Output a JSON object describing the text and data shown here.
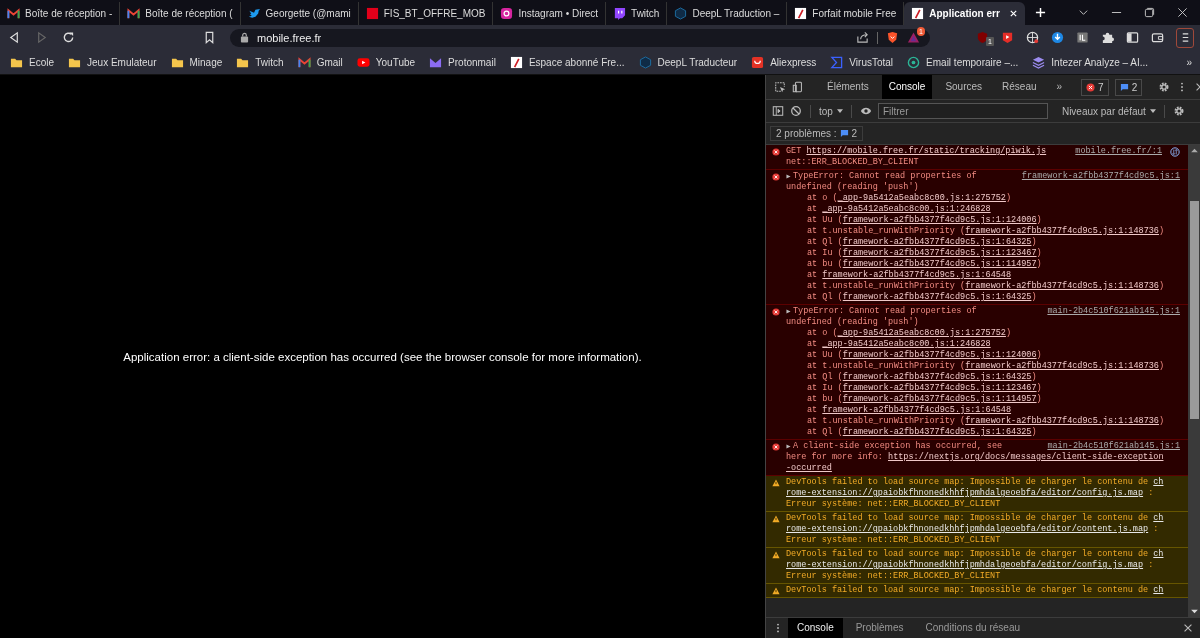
{
  "browser_tabs": [
    {
      "title": "Boîte de réception -",
      "kind": "gmail",
      "selected": false
    },
    {
      "title": "Boîte de réception (",
      "kind": "gmail",
      "selected": false
    },
    {
      "title": "Georgette (@mami",
      "kind": "twitter",
      "selected": false
    },
    {
      "title": "FIS_BT_OFFRE_MOB",
      "kind": "sfr",
      "selected": false
    },
    {
      "title": "Instagram • Direct",
      "kind": "instagram",
      "selected": false
    },
    {
      "title": "Twitch",
      "kind": "twitch",
      "selected": false
    },
    {
      "title": "DeepL Traduction –",
      "kind": "deepl",
      "selected": false
    },
    {
      "title": "Forfait mobile Free",
      "kind": "free",
      "selected": false
    },
    {
      "title": "Application err",
      "kind": "free",
      "selected": true
    }
  ],
  "toolbar": {
    "address": "mobile.free.fr",
    "rewards_badge": "1",
    "extensions": [
      {
        "kind": "shield",
        "badge": "1"
      },
      {
        "kind": "play"
      },
      {
        "kind": "globe"
      },
      {
        "kind": "download"
      },
      {
        "kind": "square"
      },
      {
        "kind": "puzzle"
      },
      {
        "kind": "sidebar"
      },
      {
        "kind": "wallet"
      }
    ]
  },
  "bookmarks": [
    {
      "label": "Ecole",
      "kind": "folder"
    },
    {
      "label": "Jeux Emulateur",
      "kind": "folder"
    },
    {
      "label": "Minage",
      "kind": "folder"
    },
    {
      "label": "Twitch",
      "kind": "folder"
    },
    {
      "label": "Gmail",
      "kind": "gmail"
    },
    {
      "label": "YouTube",
      "kind": "youtube"
    },
    {
      "label": "Protonmail",
      "kind": "proton"
    },
    {
      "label": "Espace abonné Fre...",
      "kind": "free"
    },
    {
      "label": "DeepL Traducteur",
      "kind": "deepl"
    },
    {
      "label": "Aliexpress",
      "kind": "aliexpress"
    },
    {
      "label": "VirusTotal",
      "kind": "virustotal"
    },
    {
      "label": "Email temporaire –...",
      "kind": "email"
    },
    {
      "label": "Intezer Analyze – AI...",
      "kind": "intezer"
    }
  ],
  "bookmarks_more": "»",
  "page": {
    "message": "Application error: a client-side exception has occurred (see the browser console for more information)."
  },
  "devtools": {
    "tabs": [
      {
        "label": "Éléments",
        "selected": false
      },
      {
        "label": "Console",
        "selected": true
      },
      {
        "label": "Sources",
        "selected": false
      },
      {
        "label": "Réseau",
        "selected": false
      }
    ],
    "tabs_more": "»",
    "error_count": "7",
    "message_count": "2",
    "context": "top",
    "filter_placeholder": "Filtrer",
    "levels": "Niveaux par défaut",
    "issues_label": "2 problèmes :",
    "issues_count": "2",
    "messages": [
      {
        "kind": "request",
        "source": "mobile.free.fr/:1",
        "lines": [
          [
            {
              "kind": "text",
              "text": "GET "
            },
            {
              "kind": "link",
              "text": "https://mobile.free.fr/static/tracking/piwik.js"
            }
          ],
          [
            {
              "kind": "text",
              "text": "net::ERR_BLOCKED_BY_CLIENT"
            }
          ]
        ]
      },
      {
        "kind": "exception",
        "source": "framework-a2fbb4377f4cd9c5.js:1",
        "lines": [
          [
            {
              "kind": "text",
              "text": "TypeError: Cannot read properties of"
            }
          ],
          [
            {
              "kind": "text",
              "text": "undefined (reading 'push')"
            }
          ]
        ],
        "stack": [
          [
            {
              "kind": "text",
              "text": "at o ("
            },
            {
              "kind": "link",
              "text": "_app-9a5412a5eabc8c00.js:1:275752"
            },
            {
              "kind": "text",
              "text": ")"
            }
          ],
          [
            {
              "kind": "text",
              "text": "at "
            },
            {
              "kind": "link",
              "text": "_app-9a5412a5eabc8c00.js:1:246828"
            }
          ],
          [
            {
              "kind": "text",
              "text": "at Uu ("
            },
            {
              "kind": "link",
              "text": "framework-a2fbb4377f4cd9c5.js:1:124006"
            },
            {
              "kind": "text",
              "text": ")"
            }
          ],
          [
            {
              "kind": "text",
              "text": "at t.unstable_runWithPriority ("
            },
            {
              "kind": "link",
              "text": "framework-a2fbb4377f4cd9c5.js:1:148736"
            },
            {
              "kind": "text",
              "text": ")"
            }
          ],
          [
            {
              "kind": "text",
              "text": "at Ql ("
            },
            {
              "kind": "link",
              "text": "framework-a2fbb4377f4cd9c5.js:1:64325"
            },
            {
              "kind": "text",
              "text": ")"
            }
          ],
          [
            {
              "kind": "text",
              "text": "at Iu ("
            },
            {
              "kind": "link",
              "text": "framework-a2fbb4377f4cd9c5.js:1:123467"
            },
            {
              "kind": "text",
              "text": ")"
            }
          ],
          [
            {
              "kind": "text",
              "text": "at bu ("
            },
            {
              "kind": "link",
              "text": "framework-a2fbb4377f4cd9c5.js:1:114957"
            },
            {
              "kind": "text",
              "text": ")"
            }
          ],
          [
            {
              "kind": "text",
              "text": "at "
            },
            {
              "kind": "link",
              "text": "framework-a2fbb4377f4cd9c5.js:1:64548"
            }
          ],
          [
            {
              "kind": "text",
              "text": "at t.unstable_runWithPriority ("
            },
            {
              "kind": "link",
              "text": "framework-a2fbb4377f4cd9c5.js:1:148736"
            },
            {
              "kind": "text",
              "text": ")"
            }
          ],
          [
            {
              "kind": "text",
              "text": "at Ql ("
            },
            {
              "kind": "link",
              "text": "framework-a2fbb4377f4cd9c5.js:1:64325"
            },
            {
              "kind": "text",
              "text": ")"
            }
          ]
        ]
      },
      {
        "kind": "exception",
        "source": "main-2b4c510f621ab145.js:1",
        "lines": [
          [
            {
              "kind": "text",
              "text": "TypeError: Cannot read properties of"
            }
          ],
          [
            {
              "kind": "text",
              "text": "undefined (reading 'push')"
            }
          ]
        ],
        "stack": [
          [
            {
              "kind": "text",
              "text": "at o ("
            },
            {
              "kind": "link",
              "text": "_app-9a5412a5eabc8c00.js:1:275752"
            },
            {
              "kind": "text",
              "text": ")"
            }
          ],
          [
            {
              "kind": "text",
              "text": "at "
            },
            {
              "kind": "link",
              "text": "_app-9a5412a5eabc8c00.js:1:246828"
            }
          ],
          [
            {
              "kind": "text",
              "text": "at Uu ("
            },
            {
              "kind": "link",
              "text": "framework-a2fbb4377f4cd9c5.js:1:124006"
            },
            {
              "kind": "text",
              "text": ")"
            }
          ],
          [
            {
              "kind": "text",
              "text": "at t.unstable_runWithPriority ("
            },
            {
              "kind": "link",
              "text": "framework-a2fbb4377f4cd9c5.js:1:148736"
            },
            {
              "kind": "text",
              "text": ")"
            }
          ],
          [
            {
              "kind": "text",
              "text": "at Ql ("
            },
            {
              "kind": "link",
              "text": "framework-a2fbb4377f4cd9c5.js:1:64325"
            },
            {
              "kind": "text",
              "text": ")"
            }
          ],
          [
            {
              "kind": "text",
              "text": "at Iu ("
            },
            {
              "kind": "link",
              "text": "framework-a2fbb4377f4cd9c5.js:1:123467"
            },
            {
              "kind": "text",
              "text": ")"
            }
          ],
          [
            {
              "kind": "text",
              "text": "at bu ("
            },
            {
              "kind": "link",
              "text": "framework-a2fbb4377f4cd9c5.js:1:114957"
            },
            {
              "kind": "text",
              "text": ")"
            }
          ],
          [
            {
              "kind": "text",
              "text": "at "
            },
            {
              "kind": "link",
              "text": "framework-a2fbb4377f4cd9c5.js:1:64548"
            }
          ],
          [
            {
              "kind": "text",
              "text": "at t.unstable_runWithPriority ("
            },
            {
              "kind": "link",
              "text": "framework-a2fbb4377f4cd9c5.js:1:148736"
            },
            {
              "kind": "text",
              "text": ")"
            }
          ],
          [
            {
              "kind": "text",
              "text": "at Ql ("
            },
            {
              "kind": "link",
              "text": "framework-a2fbb4377f4cd9c5.js:1:64325"
            },
            {
              "kind": "text",
              "text": ")"
            }
          ]
        ]
      },
      {
        "kind": "exception",
        "source": "main-2b4c510f621ab145.js:1",
        "lines": [
          [
            {
              "kind": "text",
              "text": "A client-side exception has occurred, see"
            }
          ],
          [
            {
              "kind": "text",
              "text": "here for more info: "
            },
            {
              "kind": "link",
              "text": "https://nextjs.org/docs/messages/client-side-exception"
            }
          ],
          [
            {
              "kind": "link",
              "text": "-occurred"
            }
          ]
        ]
      },
      {
        "kind": "warning",
        "lines": [
          [
            {
              "kind": "text",
              "text": "DevTools failed to load source map: Impossible de charger le contenu de "
            },
            {
              "kind": "link",
              "text": "ch"
            }
          ],
          [
            {
              "kind": "link",
              "text": "rome-extension://gpaiobkfhnonedkhhfjpmhdalgeoebfa/editor/config.js.map"
            },
            {
              "kind": "text",
              "text": " :"
            }
          ],
          [
            {
              "kind": "text",
              "text": "Erreur système: net::ERR_BLOCKED_BY_CLIENT"
            }
          ]
        ]
      },
      {
        "kind": "warning",
        "lines": [
          [
            {
              "kind": "text",
              "text": "DevTools failed to load source map: Impossible de charger le contenu de "
            },
            {
              "kind": "link",
              "text": "ch"
            }
          ],
          [
            {
              "kind": "link",
              "text": "rome-extension://gpaiobkfhnonedkhhfjpmhdalgeoebfa/editor/content.js.map"
            },
            {
              "kind": "text",
              "text": " :"
            }
          ],
          [
            {
              "kind": "text",
              "text": "Erreur système: net::ERR_BLOCKED_BY_CLIENT"
            }
          ]
        ]
      },
      {
        "kind": "warning",
        "lines": [
          [
            {
              "kind": "text",
              "text": "DevTools failed to load source map: Impossible de charger le contenu de "
            },
            {
              "kind": "link",
              "text": "ch"
            }
          ],
          [
            {
              "kind": "link",
              "text": "rome-extension://gpaiobkfhnonedkhhfjpmhdalgeoebfa/editor/config.js.map"
            },
            {
              "kind": "text",
              "text": " :"
            }
          ],
          [
            {
              "kind": "text",
              "text": "Erreur système: net::ERR_BLOCKED_BY_CLIENT"
            }
          ]
        ]
      },
      {
        "kind": "warning",
        "lines": [
          [
            {
              "kind": "text",
              "text": "DevTools failed to load source map: Impossible de charger le contenu de "
            },
            {
              "kind": "link",
              "text": "ch"
            }
          ]
        ]
      }
    ],
    "drawer_tabs": [
      {
        "label": "Console",
        "selected": true
      },
      {
        "label": "Problèmes",
        "selected": false
      },
      {
        "label": "Conditions du réseau",
        "selected": false
      }
    ]
  }
}
